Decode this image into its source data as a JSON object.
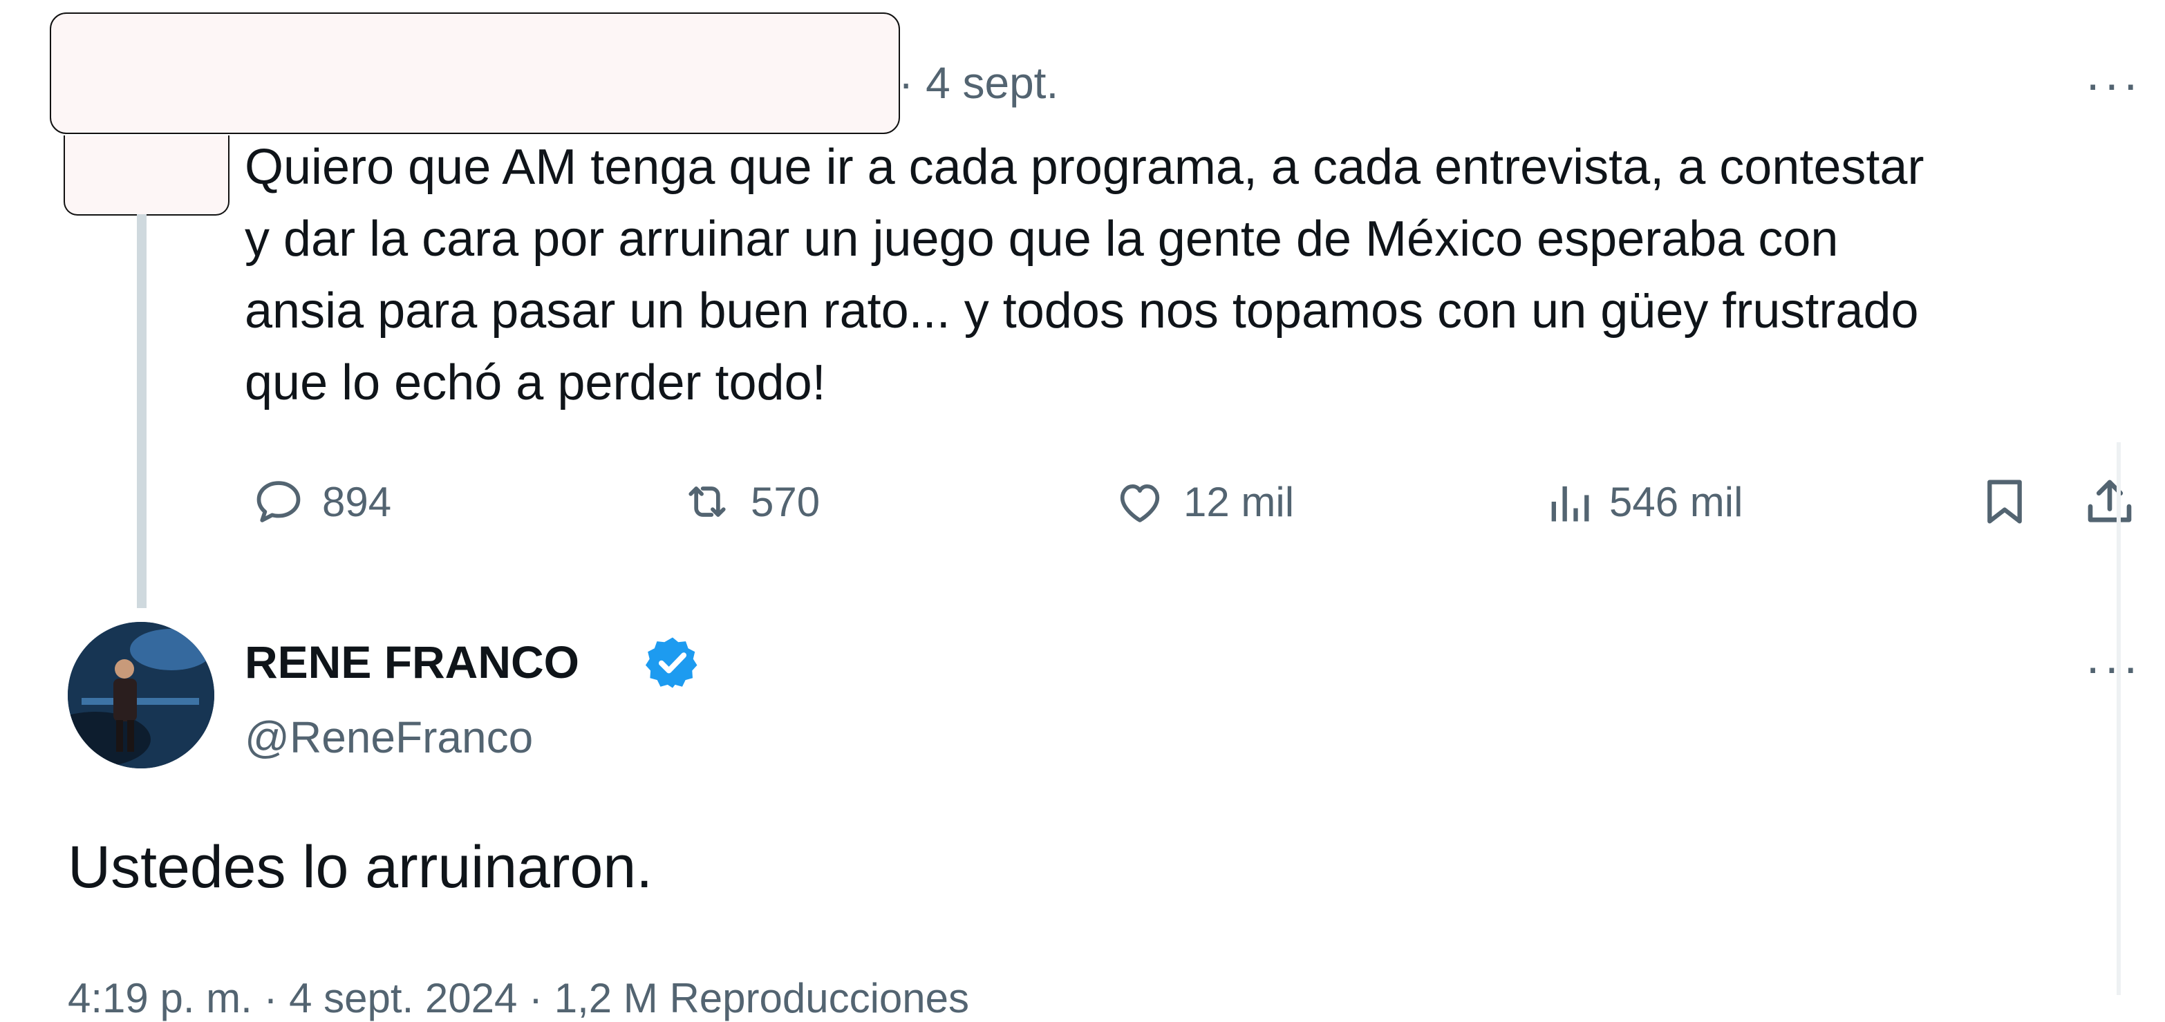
{
  "reply_tweet": {
    "date": "· 4 sept.",
    "more_label": "···",
    "text_lines": [
      "Quiero que AM tenga que ir a cada programa, a cada entrevista, a contestar",
      "y dar la cara por arruinar un juego que la gente de México esperaba con",
      "ansia para pasar un buen rato... y todos nos topamos con un güey frustrado",
      "que lo echó a perder todo!"
    ],
    "actions": {
      "replies": "894",
      "reposts": "570",
      "likes": "12 mil",
      "views": "546 mil"
    }
  },
  "main_tweet": {
    "display_name": "RENE FRANCO",
    "handle": "@ReneFranco",
    "more_label": "···",
    "text": "Ustedes lo arruinaron.",
    "footer_partial": "4:19 p. m. · 4 sept. 2024 · 1,2 M Reproducciones"
  },
  "colors": {
    "text_primary": "#0f1419",
    "text_secondary": "#536471",
    "verified_blue": "#1d9bf0",
    "thread_line": "#cfd9de"
  },
  "icons": [
    "reply-icon",
    "repost-icon",
    "like-icon",
    "views-icon",
    "bookmark-icon",
    "share-icon",
    "verified-badge-icon"
  ]
}
